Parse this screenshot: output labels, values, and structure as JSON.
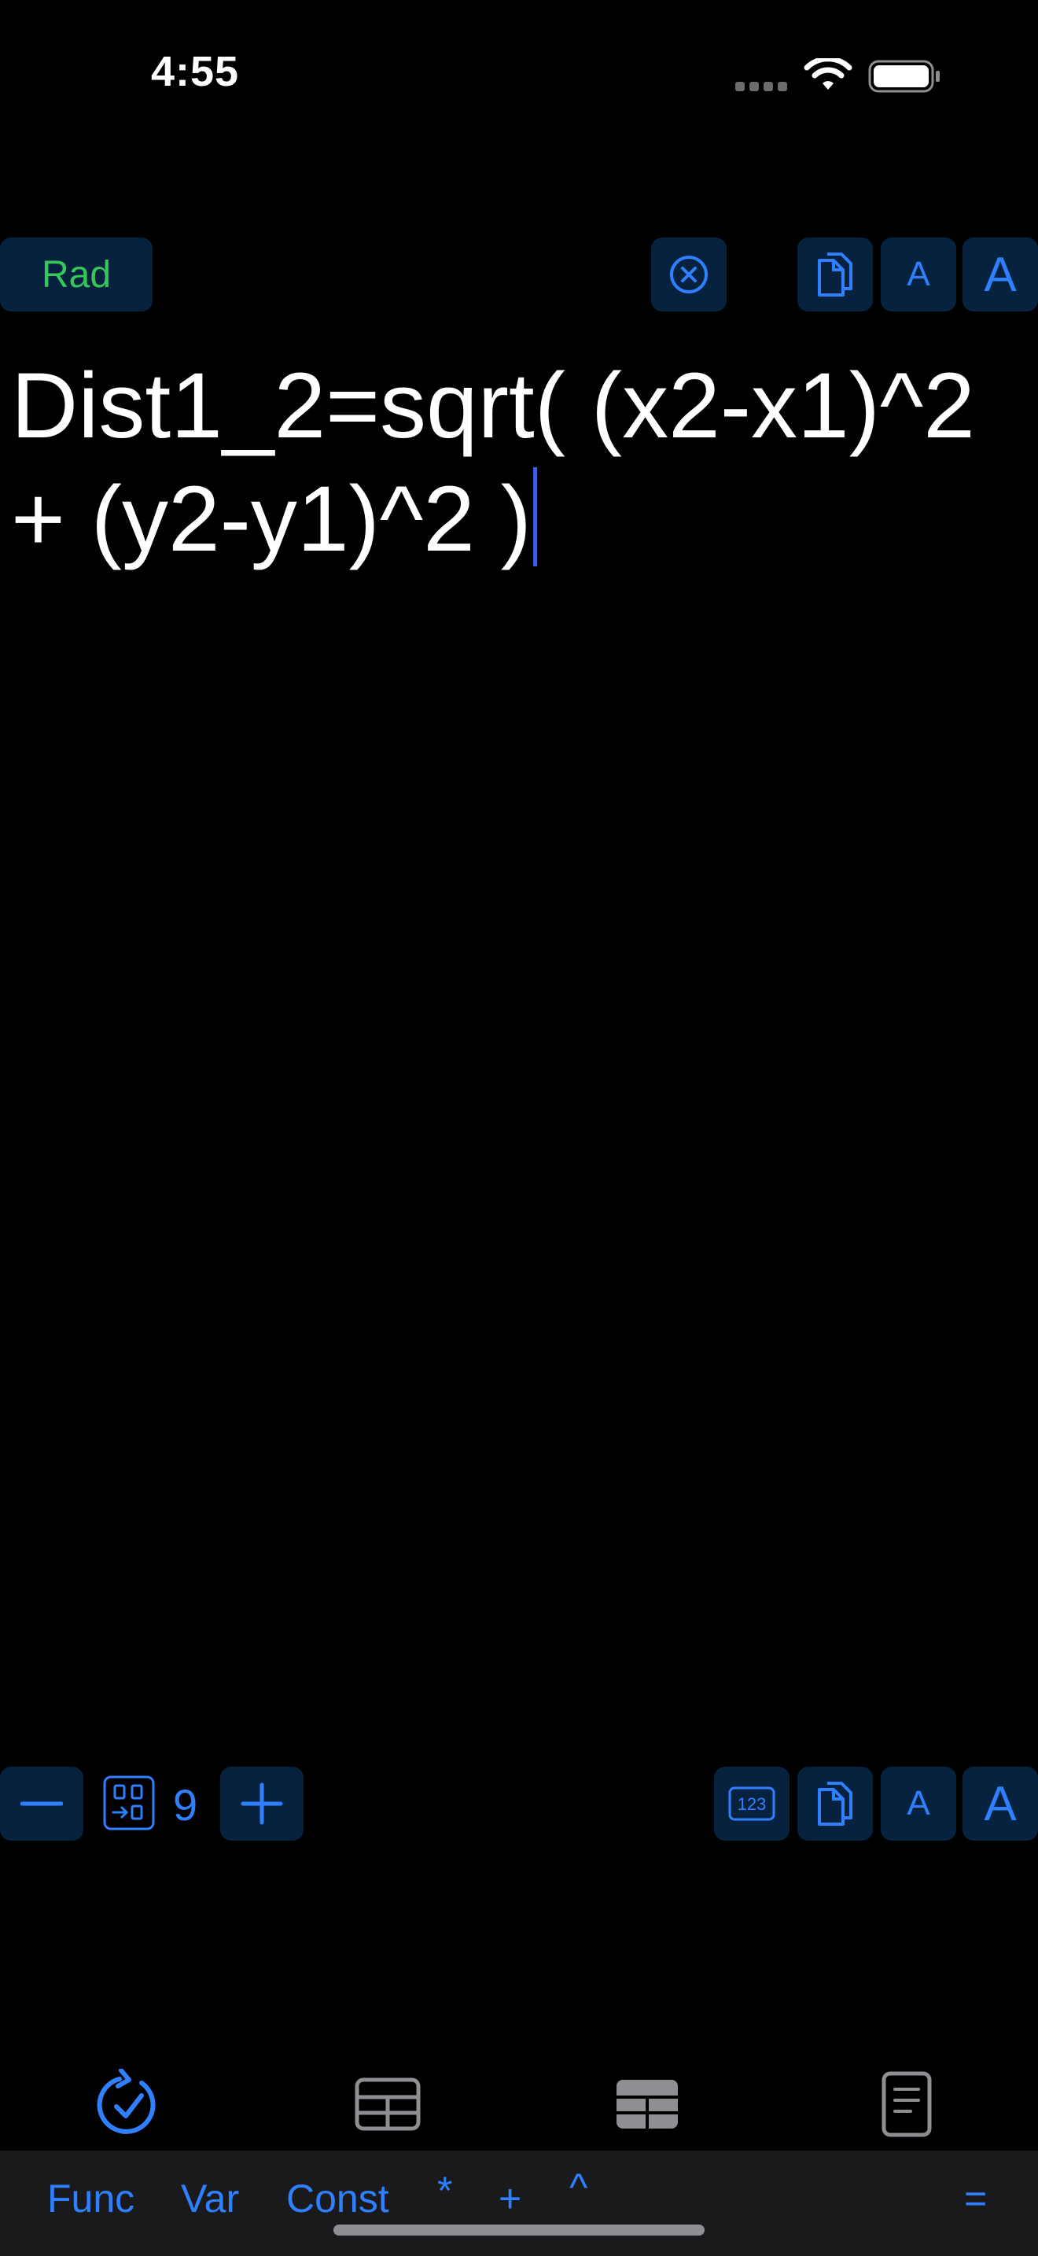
{
  "status_bar": {
    "time": "4:55"
  },
  "top_toolbar": {
    "angle_mode": "Rad",
    "font_small_label": "A",
    "font_large_label": "A"
  },
  "editor": {
    "expression": "Dist1_2=sqrt( (x2-x1)^2 + (y2-y1)^2 )"
  },
  "bottom_toolbar": {
    "decimal_places": "9",
    "font_small_label": "A",
    "font_large_label": "A"
  },
  "tab_bar": {
    "tabs": [
      {
        "icon": "solve-icon",
        "label": "Solve",
        "active": true
      },
      {
        "icon": "variables-table-icon",
        "label": "Var",
        "active": false
      },
      {
        "icon": "constants-table-icon",
        "label": "Const",
        "active": false
      },
      {
        "icon": "document-icon",
        "label": "Log",
        "active": false
      }
    ]
  },
  "accessory_bar": {
    "func": "Func",
    "var": "Var",
    "const": "Const",
    "multiply": "*",
    "plus": "+",
    "power": "^",
    "equals": "="
  },
  "colors": {
    "accent": "#2f80ff",
    "button_bg": "#07223f",
    "rad_green": "#34c759",
    "caret": "#3a5fe0"
  }
}
